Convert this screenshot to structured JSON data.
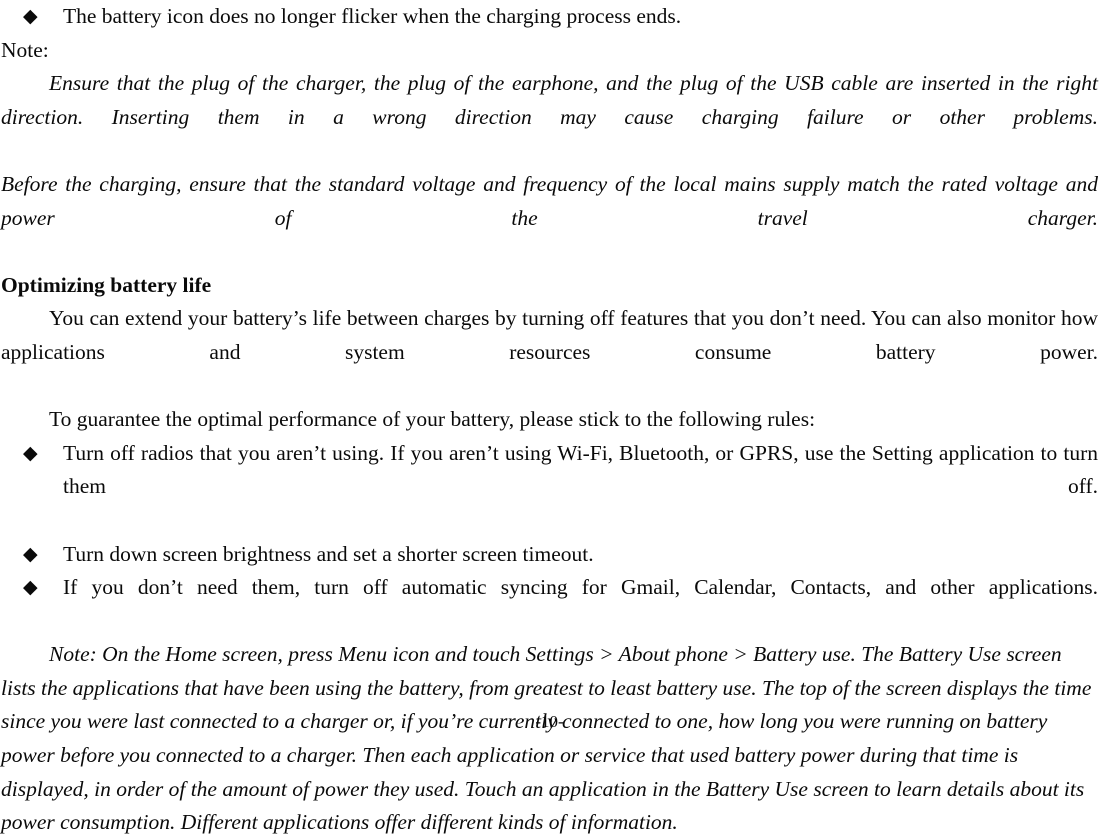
{
  "document": {
    "page_number_label": "-10-",
    "bullet_glyph": "◆",
    "text_color": "#0a0a0a",
    "background_color": "#ffffff"
  },
  "content": {
    "top_bullet": "The battery icon does no longer flicker when the charging process ends.",
    "note_label": "Note:",
    "note_paragraph_1": "Ensure that the plug of the charger, the plug of the earphone, and the plug of the USB cable are inserted in the right direction. Inserting them in a wrong direction may cause charging failure or other problems.",
    "note_paragraph_2": "Before the charging, ensure that the standard voltage and frequency of the local mains supply match the rated voltage and power of the travel charger.",
    "heading": "Optimizing battery life",
    "body_paragraph_1": "You can extend your battery’s life between charges by turning off features that you don’t need. You can also monitor how applications and system resources consume battery power.",
    "body_paragraph_2": "To guarantee the optimal performance of your battery, please stick to the following rules:",
    "rules": [
      "Turn off radios that you aren’t using. If you aren’t using Wi-Fi, Bluetooth, or GPRS, use the Setting application to turn them off.",
      "Turn down screen brightness and set a shorter screen timeout.",
      "If you don’t need them, turn off automatic syncing for Gmail, Calendar, Contacts, and other applications."
    ],
    "closing_note": "Note: On the Home screen, press Menu icon and touch Settings > About phone > Battery use. The Battery Use screen lists the applications that have been using the battery, from greatest to least battery use. The top of the screen displays the time since you were last connected to a charger or, if you’re currently connected to one, how long you were running on battery power before you connected to a charger. Then each application or service that used battery power during that time is displayed, in order of the amount of power they used. Touch an application in the Battery Use screen to learn details about its power consumption. Different applications offer different kinds of information."
  }
}
